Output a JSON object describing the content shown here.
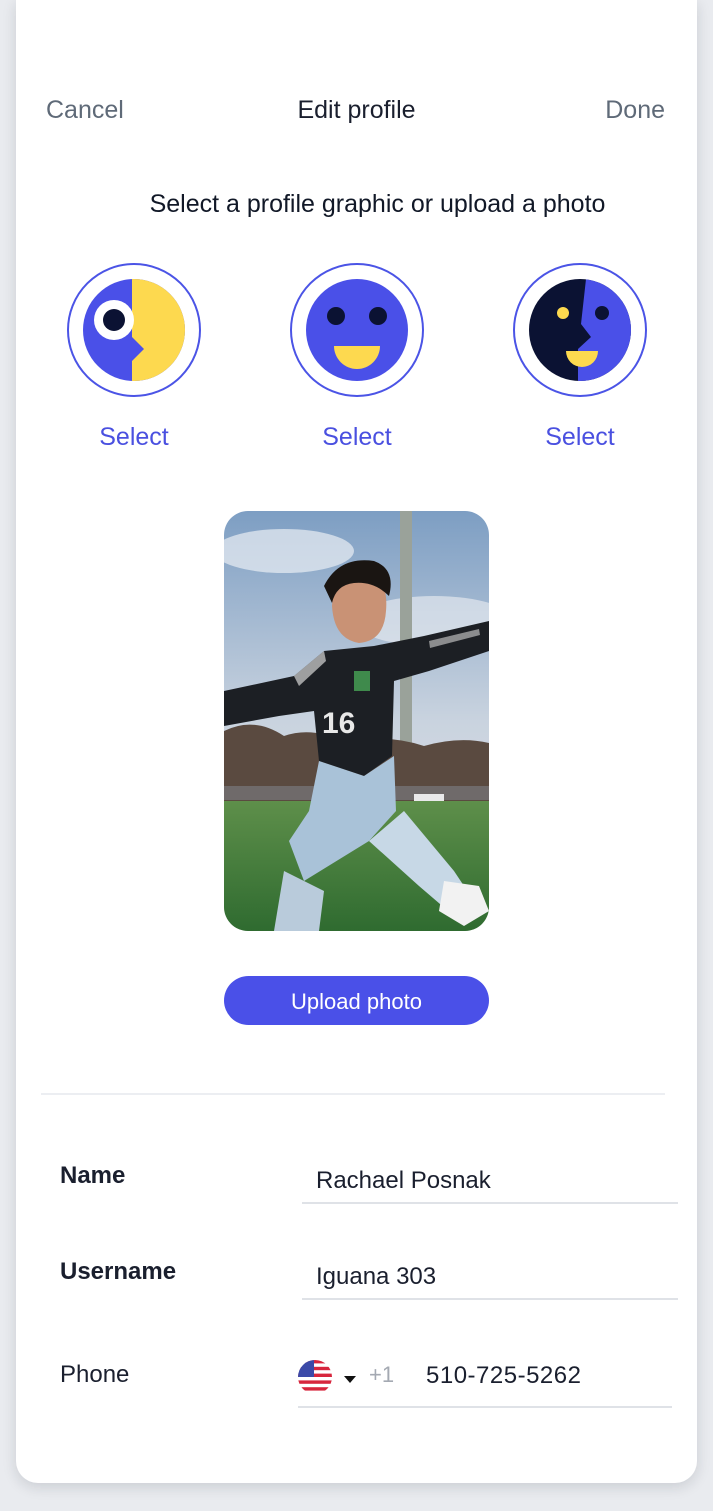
{
  "header": {
    "cancel_label": "Cancel",
    "title": "Edit profile",
    "done_label": "Done"
  },
  "instruction": "Select a profile graphic or upload a photo",
  "graphics": [
    {
      "icon": "profile-face-icon",
      "select_label": "Select"
    },
    {
      "icon": "smiley-face-icon",
      "select_label": "Select"
    },
    {
      "icon": "split-face-icon",
      "select_label": "Select"
    }
  ],
  "photo": {
    "icon": "soccer-player-photo"
  },
  "upload_label": "Upload photo",
  "form": {
    "name": {
      "label": "Name",
      "value": "Rachael Posnak"
    },
    "username": {
      "label": "Username",
      "value": "Iguana 303"
    },
    "phone": {
      "label": "Phone",
      "flag_icon": "us-flag-icon",
      "dial_code": "+1",
      "value": "510-725-5262"
    }
  },
  "colors": {
    "accent": "#4a50e8",
    "yellow": "#fdd94f",
    "navy": "#0b1233",
    "text": "#1a1f2e",
    "muted": "#5f6a78"
  }
}
